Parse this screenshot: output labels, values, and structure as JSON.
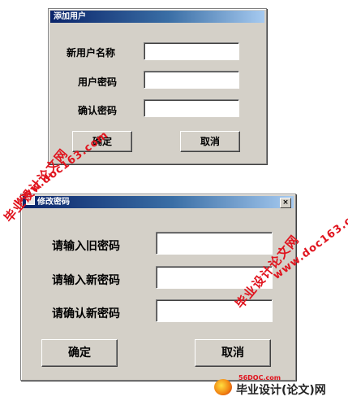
{
  "dialog_add_user": {
    "title": "添加用户",
    "labels": {
      "username": "新用户名称",
      "password": "用户密码",
      "confirm": "确认密码"
    },
    "buttons": {
      "ok": "确定",
      "cancel": "取消"
    }
  },
  "dialog_change_password": {
    "title": "修改密码",
    "close_symbol": "×",
    "labels": {
      "old": "请输入旧密码",
      "new": "请输入新密码",
      "confirm": "请确认新密码"
    },
    "buttons": {
      "ok": "确定",
      "cancel": "取消"
    }
  },
  "watermarks": {
    "cn": "毕业设计论文网",
    "url": "www.doc163.com"
  },
  "footer_logo": {
    "url": "56DOC.com",
    "text": "毕业设计(论文)网"
  }
}
